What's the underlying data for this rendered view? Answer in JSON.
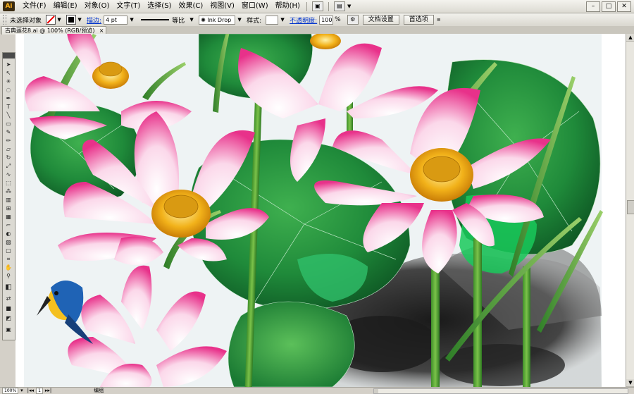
{
  "app": {
    "logo": "Ai"
  },
  "menu": [
    "文件(F)",
    "编辑(E)",
    "对象(O)",
    "文字(T)",
    "选择(S)",
    "效果(C)",
    "视图(V)",
    "窗口(W)",
    "帮助(H)"
  ],
  "control_bar": {
    "selection_label": "未选择对象",
    "stroke_link": "描边:",
    "stroke_weight": "4 pt",
    "profile_label": "等比",
    "brush_name": "Ink Drop",
    "style_label": "样式:",
    "opacity_link": "不透明度:",
    "opacity_value": "100",
    "opacity_unit": "%",
    "doc_setup_button": "文档设置",
    "preferences_button": "首选项"
  },
  "document_tab": {
    "title": "古典莲花8.ai @ 100% (RGB/预览)",
    "close": "×"
  },
  "status_bar": {
    "zoom": "100%",
    "page": "1",
    "status": "编组"
  },
  "icons": [
    "pen-icon",
    "type-icon",
    "selection-icon",
    "zoom-icon",
    "hand-icon",
    "color-swatch-icon"
  ],
  "colors": {
    "lotus_pink": "#e8318a",
    "leaf_green": "#1f8a3a",
    "stamen_gold": "#f2b21a",
    "ink_dark": "#2a2a2a"
  }
}
